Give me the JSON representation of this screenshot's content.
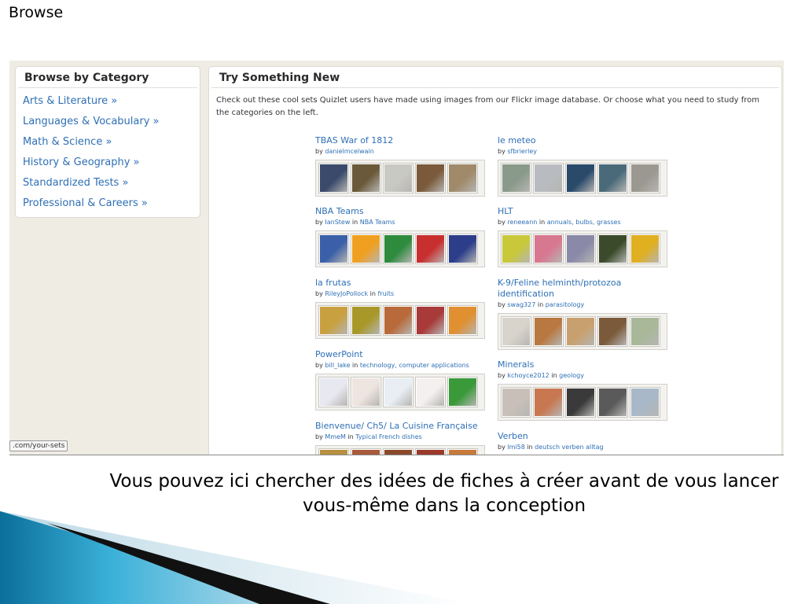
{
  "slide": {
    "title": "Browse",
    "caption": "Vous pouvez ici chercher des idées de fiches à créer avant de vous lancer vous-même dans la conception"
  },
  "sidebar": {
    "heading": "Browse by Category",
    "items": [
      {
        "label": "Arts & Literature »"
      },
      {
        "label": "Languages & Vocabulary »"
      },
      {
        "label": "Math & Science »"
      },
      {
        "label": "History & Geography »"
      },
      {
        "label": "Standardized Tests »"
      },
      {
        "label": "Professional & Careers »"
      }
    ]
  },
  "main": {
    "heading": "Try Something New",
    "intro": "Check out these cool sets Quizlet users have made using images from our Flickr image database. Or choose what you need to study from the categories on the left.",
    "sets": [
      {
        "title": "TBAS War of 1812",
        "by": "by",
        "user": "danielmcelwain",
        "in": "",
        "cats": "",
        "colors": [
          "#3b4a6b",
          "#6b5a3a",
          "#c9c9c4",
          "#7a5a3a",
          "#a08a6a"
        ]
      },
      {
        "title": "le meteo",
        "by": "by",
        "user": "sfbrierley",
        "in": "",
        "cats": "",
        "colors": [
          "#8a9a8a",
          "#b8bcc0",
          "#2a4a6a",
          "#4a6a7a",
          "#9a9890"
        ]
      },
      {
        "title": "NBA Teams",
        "by": "by",
        "user": "IanStew",
        "in": "in",
        "cats": "NBA Teams",
        "colors": [
          "#3b5fa8",
          "#f0a020",
          "#2e8b3e",
          "#c83030",
          "#2c3e8a"
        ]
      },
      {
        "title": "HLT",
        "by": "by",
        "user": "reneeann",
        "in": "in",
        "cats": "annuals, bulbs, grasses",
        "colors": [
          "#c8c83a",
          "#d87890",
          "#8a8aa8",
          "#3a4a2a",
          "#e0b020"
        ]
      },
      {
        "title": "la frutas",
        "by": "by",
        "user": "RileyJoPollock",
        "in": "in",
        "cats": "fruits",
        "colors": [
          "#c8a040",
          "#a8982a",
          "#b86a3a",
          "#a83a3a",
          "#e09030"
        ]
      },
      {
        "title": "K-9/Feline helminth/protozoa identification",
        "by": "by",
        "user": "swag327",
        "in": "in",
        "cats": "parasitology",
        "colors": [
          "#d8d4cc",
          "#b87840",
          "#c8a070",
          "#7a5a3a",
          "#a8b898"
        ]
      },
      {
        "title": "PowerPoint",
        "by": "by",
        "user": "bill_lake",
        "in": "in",
        "cats": "technology, computer applications",
        "colors": [
          "#e8e8f0",
          "#eee4e0",
          "#e8eef4",
          "#f4f0f0",
          "#3a9a3a"
        ]
      },
      {
        "title": "Minerals",
        "by": "by",
        "user": "kchoyce2012",
        "in": "in",
        "cats": "geology",
        "colors": [
          "#c8c0b8",
          "#c87850",
          "#3a3a3a",
          "#5a5a5a",
          "#a8b8c8"
        ]
      },
      {
        "title": "Bienvenue/ Ch5/ La Cuisine Française",
        "by": "by",
        "user": "MmeM",
        "in": "in",
        "cats": "Typical French dishes",
        "colors": [
          "#b89040",
          "#a85a3a",
          "#8a4a2a",
          "#9a3a2a",
          "#c87a3a"
        ]
      },
      {
        "title": "Verben",
        "by": "by",
        "user": "lmi58",
        "in": "in",
        "cats": "deutsch verben alltag",
        "colors": [
          "#d8d8d8",
          "#d8d8d8",
          "#d8d8d8",
          "#d8d8d8",
          "#d8d8d8"
        ]
      }
    ]
  },
  "status_tip": ".com/your-sets",
  "colors": {
    "link": "#2e6fb5",
    "frame_bg": "#efece4",
    "deco_blue": "#1f8fb8",
    "deco_dark": "#111111"
  }
}
